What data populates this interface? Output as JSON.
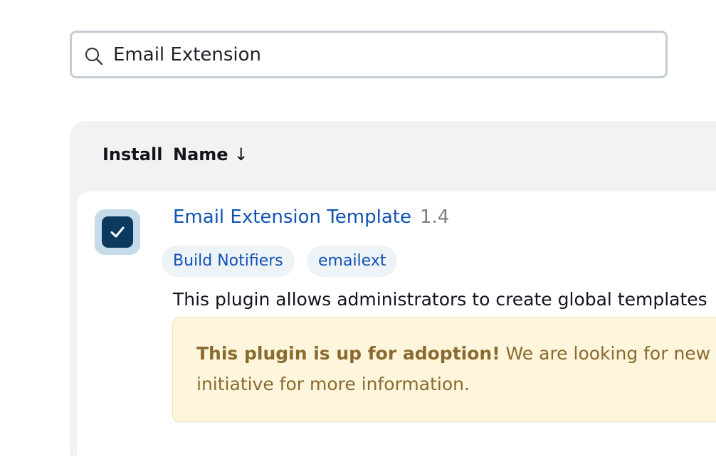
{
  "search": {
    "value": "Email Extension",
    "icon": "search-icon"
  },
  "table": {
    "columns": {
      "install": "Install",
      "name": "Name",
      "sort_indicator": "↓"
    }
  },
  "plugin": {
    "checked": true,
    "name": "Email Extension Template",
    "version": "1.4",
    "tags": [
      "Build Notifiers",
      "emailext"
    ],
    "description": "This plugin allows administrators to create global templates",
    "adoption": {
      "strong": "This plugin is up for adoption!",
      "text_line1": " We are looking for new",
      "text_line2": "initiative for more information."
    }
  },
  "colors": {
    "link": "#1152b5",
    "checkbox": "#0b3a5e",
    "adoption_bg": "#fdf5dc",
    "adoption_text": "#8a6a2f"
  }
}
